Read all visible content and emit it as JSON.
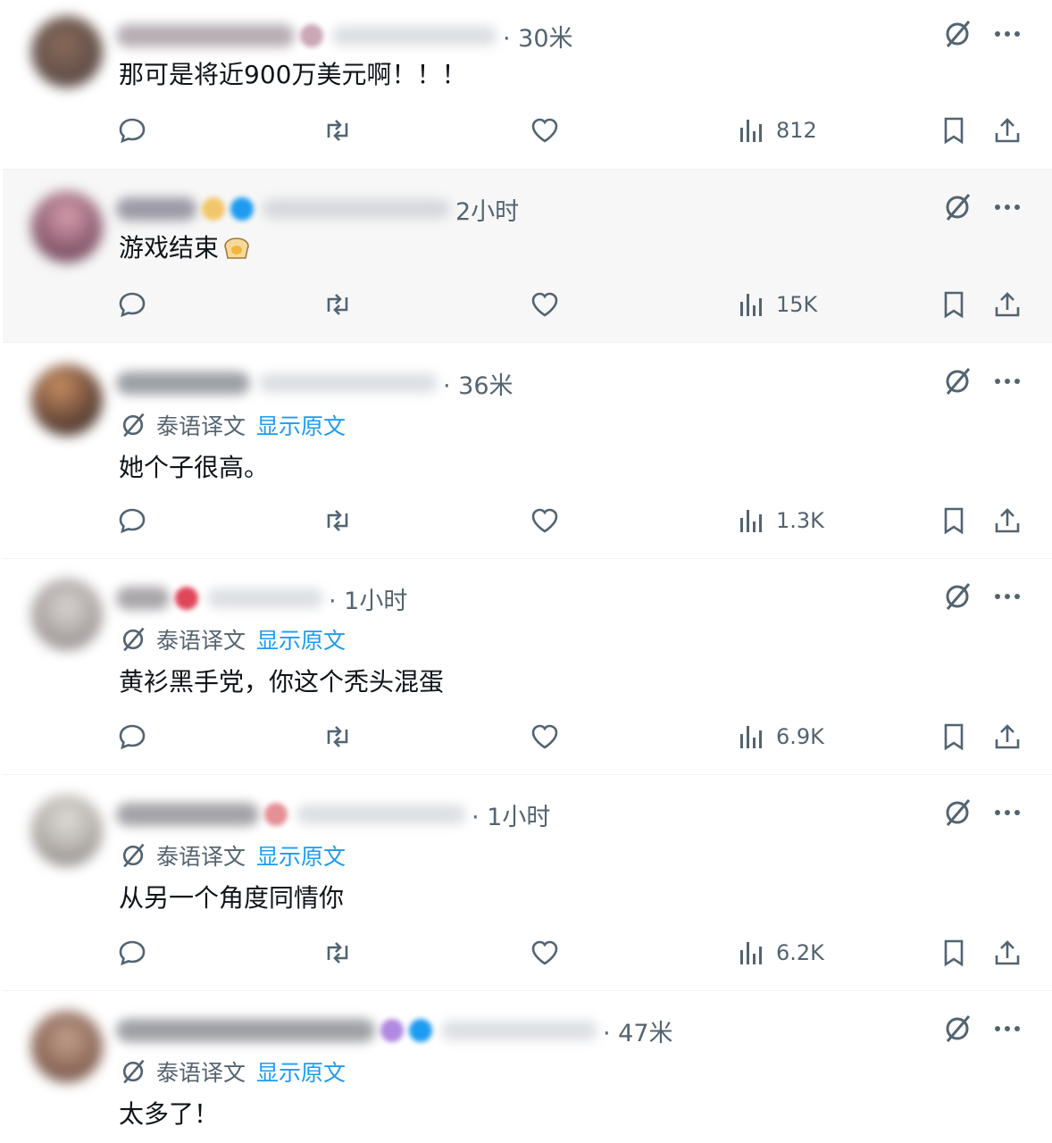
{
  "posts": [
    {
      "time": "· 30米",
      "text": "那可是将近900万美元啊！！！",
      "views": "812",
      "show_translation": false
    },
    {
      "time": "2小时",
      "text": "游戏结束",
      "views": "15K",
      "show_translation": false,
      "highlighted": true
    },
    {
      "time": "· 36米",
      "text": "她个子很高。",
      "views": "1.3K",
      "show_translation": true
    },
    {
      "time": "· 1小时",
      "text": "黄衫黑手党，你这个秃头混蛋",
      "views": "6.9K",
      "show_translation": true
    },
    {
      "time": "· 1小时",
      "text": "从另一个角度同情你",
      "views": "6.2K",
      "show_translation": true
    },
    {
      "time": "· 47米",
      "text": "太多了！",
      "views": "",
      "show_translation": true
    }
  ],
  "translation": {
    "label": "泰语译文",
    "link": "显示原文"
  },
  "colors": {
    "accent": "#1d9bf0",
    "muted": "#536471",
    "text": "#0f1419",
    "highlight_bg": "#f7f7f7"
  },
  "icons": [
    "grok-icon",
    "more-icon",
    "reply-icon",
    "repost-icon",
    "like-icon",
    "views-icon",
    "bookmark-icon",
    "share-icon"
  ]
}
